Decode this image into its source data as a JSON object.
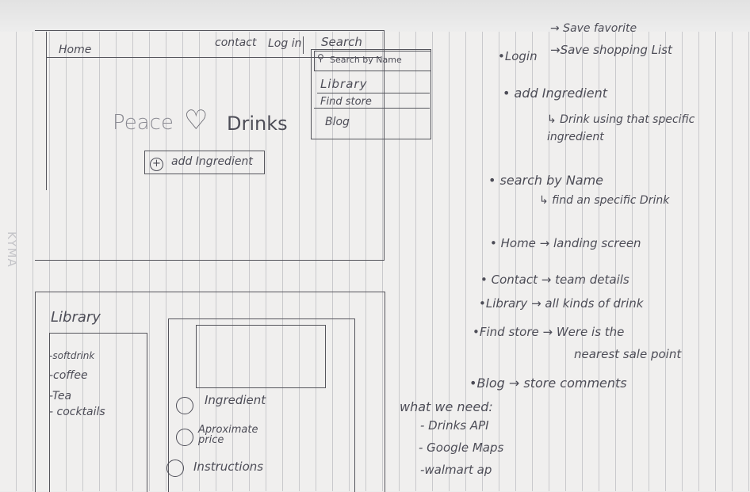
{
  "navbar": {
    "home": "Home",
    "contact": "contact",
    "login": "Log in",
    "search": "Search"
  },
  "dropdown": {
    "search_placeholder": "Search by Name",
    "items": [
      "Library",
      "Find store",
      "Blog"
    ]
  },
  "hero": {
    "title_left": "Peace",
    "heart": "♡",
    "title_right": "Drinks",
    "add_button": "add Ingredient",
    "add_icon": "+"
  },
  "library": {
    "heading": "Library",
    "items": [
      "-softdrink",
      "-coffee",
      "-Tea",
      "- cocktails"
    ]
  },
  "detail": {
    "options": [
      "Ingredient",
      "Aproximate price",
      "Instructions"
    ]
  },
  "notes": {
    "login": "•Login",
    "login_sub1": "→ Save favorite",
    "login_sub2": "→Save shopping List",
    "add_ingredient": "• add Ingredient",
    "add_ingredient_sub": "↳ Drink using that specific ingredient",
    "search": "• search by Name",
    "search_sub": "↳ find an specific Drink",
    "home": "• Home → landing screen",
    "contact": "• Contact → team details",
    "library": "•Library → all kinds of drink",
    "find_store": "•Find store → Were is the",
    "find_store_2": "nearest sale point",
    "blog": "•Blog → store comments",
    "need_title": "what we need:",
    "need_items": [
      "- Drinks API",
      "- Google Maps",
      "-walmart ap"
    ]
  },
  "watermark": "KYMA"
}
